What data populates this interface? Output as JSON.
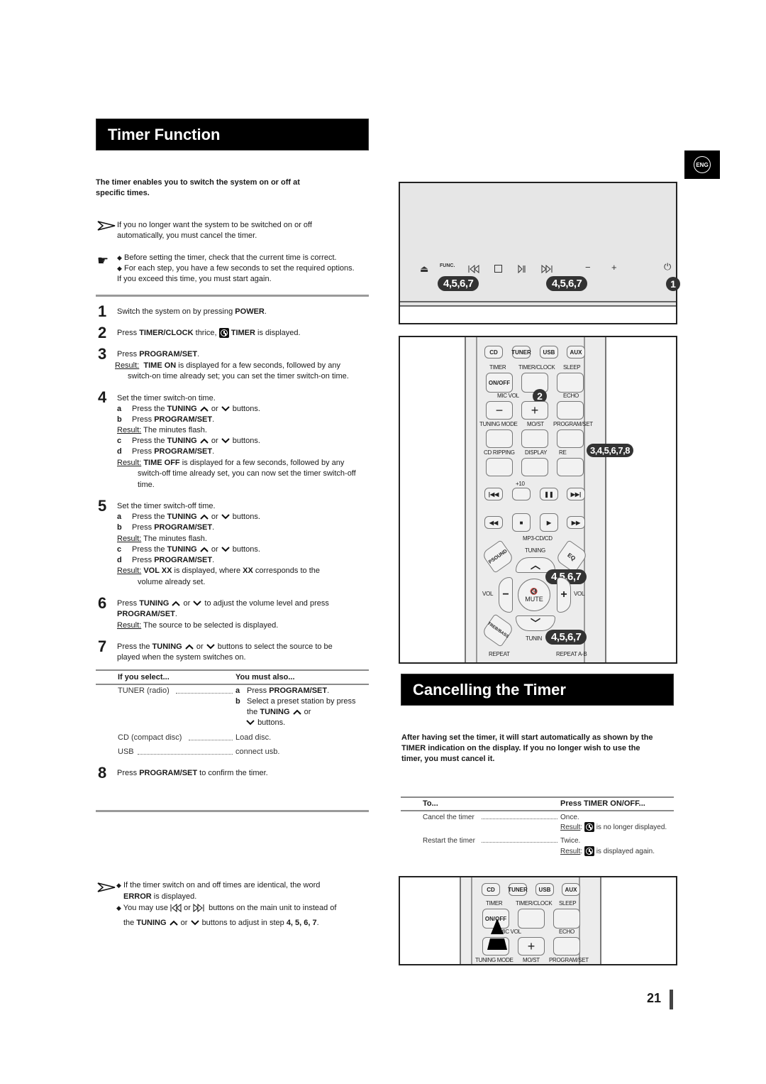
{
  "page": {
    "number": "21",
    "language_badge": "ENG"
  },
  "timer_function": {
    "title": "Timer Function",
    "intro_line1": "The timer enables you to switch the system on or off at",
    "intro_line2": "specific times.",
    "note_arrow_line1": "If you no longer want the system to be switched on or off",
    "note_arrow_line2": "automatically, you must cancel the timer.",
    "note_hand_line1": "Before setting the timer, check that the current time is correct.",
    "note_hand_line2": "For each step, you have a few seconds to set the required options.",
    "note_hand_line3": "If you exceed this time, you must start again.",
    "steps": [
      {
        "num": "1",
        "pre": "Switch the system on by pressing ",
        "bold": "POWER",
        "post": "."
      },
      {
        "num": "2",
        "pre": "Press ",
        "bold": "TIMER/CLOCK",
        "mid": " thrice, ",
        "bold2": "TIMER",
        "post": " is displayed."
      },
      {
        "num": "3",
        "pre": "Press ",
        "bold": "PROGRAM/SET",
        "post": ".",
        "result_label": "Result:",
        "result_bold": "TIME ON",
        "result_text": " is displayed for a few seconds, followed by any",
        "result_line2": "switch-on time already set; you can set the timer switch-on time."
      },
      {
        "num": "4",
        "text": "Set the timer switch-on time.",
        "a": "Press the ",
        "a_bold": "TUNING",
        "a_or": "or",
        "a_post": "buttons.",
        "b": "Press ",
        "b_bold": "PROGRAM/SET",
        "b_post": ".",
        "result1_label": "Result:",
        "result1_text": " The minutes flash.",
        "c": "Press the ",
        "c_bold": "TUNING",
        "c_or": "or",
        "c_post": "buttons.",
        "d": "Press ",
        "d_bold": "PROGRAM/SET",
        "d_post": ".",
        "result2_label": "Result:",
        "result2_bold": "TIME OFF",
        "result2_text": " is displayed for a few seconds, followed by any",
        "result2_line2": "switch-off time already set, you can now set the timer switch-off",
        "result2_line3": "time."
      },
      {
        "num": "5",
        "text": "Set the timer switch-off time.",
        "a": "Press the ",
        "a_bold": "TUNING",
        "a_or": "or",
        "a_post": "buttons.",
        "b": "Press ",
        "b_bold": "PROGRAM/SET",
        "b_post": ".",
        "result1_label": "Result:",
        "result1_text": " The minutes flash.",
        "c": "Press the ",
        "c_bold": "TUNING",
        "c_or": "or",
        "c_post": "buttons.",
        "d": "Press ",
        "d_bold": "PROGRAM/SET",
        "d_post": ".",
        "result2_label": "Result:",
        "result2_bold": "VOL XX",
        "result2_text": " is displayed, where ",
        "result2_bold2": "XX",
        "result2_text2": " corresponds to the",
        "result2_line2": "volume already set."
      },
      {
        "num": "6",
        "pre": "Press ",
        "bold": "TUNING",
        "or": "or",
        "post": "to adjust the volume level and press",
        "line2_bold": "PROGRAM/SET",
        "line2_post": ".",
        "result_label": "Result:",
        "result_text": " The source to be selected is displayed."
      },
      {
        "num": "7",
        "pre": "Press the ",
        "bold": "TUNING",
        "or": "or",
        "post": "buttons to select the source to be",
        "line2": "played when the system switches on."
      },
      {
        "num": "8",
        "pre": "Press ",
        "bold": "PROGRAM/SET",
        "post": " to confirm the timer."
      }
    ],
    "source_table": {
      "headers": [
        "If you select...",
        "You must also..."
      ],
      "rows": [
        {
          "select": "TUNER (radio)",
          "a_letter": "a",
          "a_text": "Press ",
          "a_bold": "PROGRAM/SET",
          "a_post": ".",
          "b_letter": "b",
          "b_text": "Select a preset station by press",
          "b_line2_pre": "the ",
          "b_line2_bold": "TUNING",
          "b_line2_or": "or",
          "b_line3": "buttons."
        },
        {
          "select": "CD (compact disc)",
          "action": "Load disc."
        },
        {
          "select": "USB",
          "action": "connect usb."
        }
      ]
    },
    "bottom_note": {
      "line1": "If the timer switch on and off times are identical, the word",
      "line2_bold": "ERROR",
      "line2": " is displayed.",
      "line3_pre": "You may use",
      "line3_or": "or",
      "line3_post": "buttons on the main unit to instead of",
      "line4_pre": "the ",
      "line4_bold": "TUNING",
      "line4_or": "or",
      "line4_post": "buttons to adjust in step ",
      "line4_steps": "4, 5, 6, 7",
      "line4_end": "."
    }
  },
  "main_unit_panel": {
    "func_label": "FUNC.",
    "callout_left": "4,5,6,7",
    "callout_mid": "4,5,6,7",
    "callout_power": "1"
  },
  "remote": {
    "buttons_row1": [
      "CD",
      "TUNER",
      "USB",
      "AUX"
    ],
    "labels_row2": [
      "TIMER",
      "TIMER/CLOCK",
      "SLEEP"
    ],
    "on_off": "ON/OFF",
    "mic_vol": "MIC VOL",
    "echo": "ECHO",
    "labels_row4": [
      "TUNING MODE",
      "MO/ST",
      "PROGRAM/SET"
    ],
    "labels_row5": [
      "CD RIPPING",
      "DISPLAY",
      "RE"
    ],
    "plus10": "+10",
    "mp3cd": "MP3-CD/CD",
    "psound": "PSOUND",
    "tuning": "TUNING",
    "eq": "EQ",
    "vol": "VOL",
    "mute": "MUTE",
    "treb_bass": "TREB/BASS",
    "tunin": "TUNIN",
    "repeat": "REPEAT",
    "repeat_ab": "REPEAT A-B",
    "callout_2": "2",
    "callout_program": "3,4,5,6,7,8",
    "callout_tuning_up": "4,5,6,7",
    "callout_tuning_down": "4,5,6,7"
  },
  "cancelling_timer": {
    "title": "Cancelling the Timer",
    "intro_line1": "After having set the timer, it will start automatically as shown by the",
    "intro_line2": "TIMER indication on the display. If you no longer wish to use the",
    "intro_line3": "timer, you must cancel it.",
    "table": {
      "headers": [
        "To...",
        "Press TIMER ON/OFF..."
      ],
      "rows": [
        {
          "to": "Cancel the timer",
          "press": "Once.",
          "result_label": "Result",
          "result_text": " is no longer displayed."
        },
        {
          "to": "Restart the timer",
          "press": "Twice.",
          "result_label": "Result",
          "result_text": " is displayed again."
        }
      ]
    }
  },
  "remote_small": {
    "buttons_row1": [
      "CD",
      "TUNER",
      "USB",
      "AUX"
    ],
    "labels_row2": [
      "TIMER",
      "TIMER/CLOCK",
      "SLEEP"
    ],
    "on_off": "ON/OFF",
    "mic_vol": "MIC VOL",
    "echo": "ECHO",
    "labels_row4": [
      "TUNING MODE",
      "MO/ST",
      "PROGRAM/SET"
    ]
  }
}
